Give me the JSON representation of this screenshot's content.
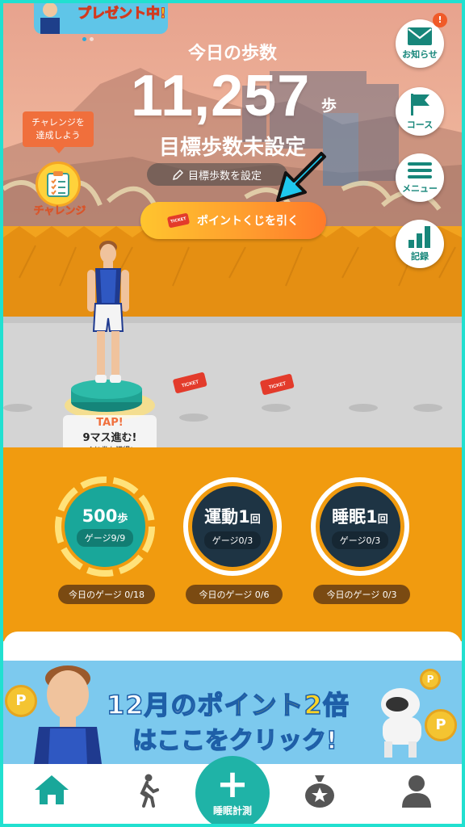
{
  "promo_top": {
    "text": "プレゼント中!"
  },
  "today_steps": {
    "label": "今日の歩数",
    "count": "11,257",
    "unit": "歩"
  },
  "goal": {
    "status": "目標歩数未設定",
    "set_button": "目標歩数を設定"
  },
  "lottery_button": {
    "label": "ポイントくじを引く",
    "ticket_text": "TICKET"
  },
  "challenge": {
    "tooltip_line1": "チャレンジを",
    "tooltip_line2": "達成しよう",
    "label": "チャレンジ"
  },
  "side_menu": [
    {
      "label": "お知らせ",
      "icon": "mail-icon",
      "badge": "!"
    },
    {
      "label": "コース",
      "icon": "flag-icon"
    },
    {
      "label": "メニュー",
      "icon": "hamburger-icon"
    },
    {
      "label": "記録",
      "icon": "bar-chart-icon"
    }
  ],
  "tap_callout": {
    "tap": "TAP!",
    "advance": "9マス進む!",
    "note": "くじ券も獲得!"
  },
  "gauges": [
    {
      "main": "500",
      "unit": "歩",
      "gauge": "ゲージ9/9",
      "today": "今日のゲージ 0/18",
      "progress": 1.0
    },
    {
      "main": "運動1",
      "unit": "回",
      "gauge": "ゲージ0/3",
      "today": "今日のゲージ 0/6",
      "progress": 0.0
    },
    {
      "main": "睡眠1",
      "unit": "回",
      "gauge": "ゲージ0/3",
      "today": "今日のゲージ 0/3",
      "progress": 0.0
    }
  ],
  "banner": {
    "line1_a": "12月の",
    "line1_highlight": "ポイント2",
    "line1_b": "倍",
    "line2": "はここをクリック!",
    "coin": "P"
  },
  "tabbar": {
    "center_label": "睡眠計測",
    "tabs": [
      "home-icon",
      "walk-icon",
      "plus-icon",
      "moneybag-icon",
      "profile-icon"
    ]
  },
  "colors": {
    "accent": "#1fb3a7",
    "orange": "#f19b0f",
    "dark_gauge": "#1e3444",
    "notice": "#f05a28"
  }
}
